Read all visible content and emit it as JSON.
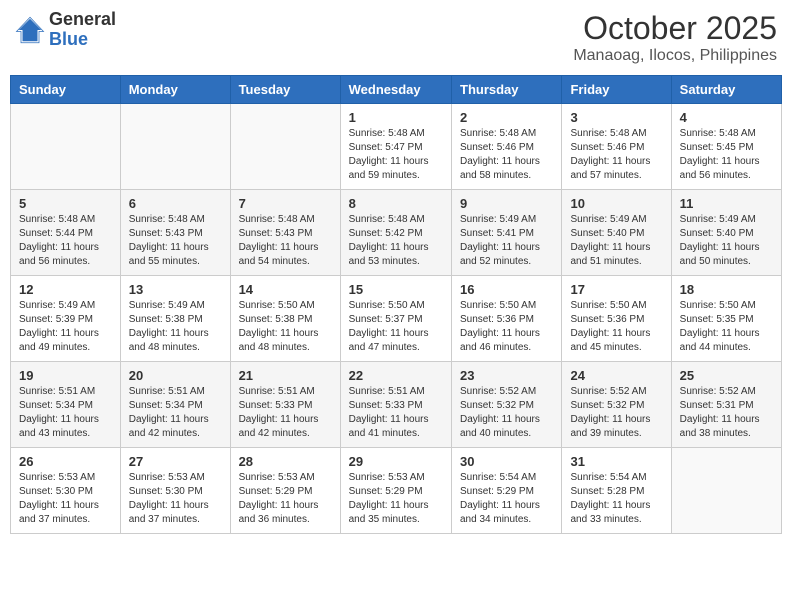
{
  "header": {
    "logo_general": "General",
    "logo_blue": "Blue",
    "month_title": "October 2025",
    "subtitle": "Manaoag, Ilocos, Philippines"
  },
  "days_of_week": [
    "Sunday",
    "Monday",
    "Tuesday",
    "Wednesday",
    "Thursday",
    "Friday",
    "Saturday"
  ],
  "weeks": [
    [
      {
        "day": "",
        "info": ""
      },
      {
        "day": "",
        "info": ""
      },
      {
        "day": "",
        "info": ""
      },
      {
        "day": "1",
        "info": "Sunrise: 5:48 AM\nSunset: 5:47 PM\nDaylight: 11 hours\nand 59 minutes."
      },
      {
        "day": "2",
        "info": "Sunrise: 5:48 AM\nSunset: 5:46 PM\nDaylight: 11 hours\nand 58 minutes."
      },
      {
        "day": "3",
        "info": "Sunrise: 5:48 AM\nSunset: 5:46 PM\nDaylight: 11 hours\nand 57 minutes."
      },
      {
        "day": "4",
        "info": "Sunrise: 5:48 AM\nSunset: 5:45 PM\nDaylight: 11 hours\nand 56 minutes."
      }
    ],
    [
      {
        "day": "5",
        "info": "Sunrise: 5:48 AM\nSunset: 5:44 PM\nDaylight: 11 hours\nand 56 minutes."
      },
      {
        "day": "6",
        "info": "Sunrise: 5:48 AM\nSunset: 5:43 PM\nDaylight: 11 hours\nand 55 minutes."
      },
      {
        "day": "7",
        "info": "Sunrise: 5:48 AM\nSunset: 5:43 PM\nDaylight: 11 hours\nand 54 minutes."
      },
      {
        "day": "8",
        "info": "Sunrise: 5:48 AM\nSunset: 5:42 PM\nDaylight: 11 hours\nand 53 minutes."
      },
      {
        "day": "9",
        "info": "Sunrise: 5:49 AM\nSunset: 5:41 PM\nDaylight: 11 hours\nand 52 minutes."
      },
      {
        "day": "10",
        "info": "Sunrise: 5:49 AM\nSunset: 5:40 PM\nDaylight: 11 hours\nand 51 minutes."
      },
      {
        "day": "11",
        "info": "Sunrise: 5:49 AM\nSunset: 5:40 PM\nDaylight: 11 hours\nand 50 minutes."
      }
    ],
    [
      {
        "day": "12",
        "info": "Sunrise: 5:49 AM\nSunset: 5:39 PM\nDaylight: 11 hours\nand 49 minutes."
      },
      {
        "day": "13",
        "info": "Sunrise: 5:49 AM\nSunset: 5:38 PM\nDaylight: 11 hours\nand 48 minutes."
      },
      {
        "day": "14",
        "info": "Sunrise: 5:50 AM\nSunset: 5:38 PM\nDaylight: 11 hours\nand 48 minutes."
      },
      {
        "day": "15",
        "info": "Sunrise: 5:50 AM\nSunset: 5:37 PM\nDaylight: 11 hours\nand 47 minutes."
      },
      {
        "day": "16",
        "info": "Sunrise: 5:50 AM\nSunset: 5:36 PM\nDaylight: 11 hours\nand 46 minutes."
      },
      {
        "day": "17",
        "info": "Sunrise: 5:50 AM\nSunset: 5:36 PM\nDaylight: 11 hours\nand 45 minutes."
      },
      {
        "day": "18",
        "info": "Sunrise: 5:50 AM\nSunset: 5:35 PM\nDaylight: 11 hours\nand 44 minutes."
      }
    ],
    [
      {
        "day": "19",
        "info": "Sunrise: 5:51 AM\nSunset: 5:34 PM\nDaylight: 11 hours\nand 43 minutes."
      },
      {
        "day": "20",
        "info": "Sunrise: 5:51 AM\nSunset: 5:34 PM\nDaylight: 11 hours\nand 42 minutes."
      },
      {
        "day": "21",
        "info": "Sunrise: 5:51 AM\nSunset: 5:33 PM\nDaylight: 11 hours\nand 42 minutes."
      },
      {
        "day": "22",
        "info": "Sunrise: 5:51 AM\nSunset: 5:33 PM\nDaylight: 11 hours\nand 41 minutes."
      },
      {
        "day": "23",
        "info": "Sunrise: 5:52 AM\nSunset: 5:32 PM\nDaylight: 11 hours\nand 40 minutes."
      },
      {
        "day": "24",
        "info": "Sunrise: 5:52 AM\nSunset: 5:32 PM\nDaylight: 11 hours\nand 39 minutes."
      },
      {
        "day": "25",
        "info": "Sunrise: 5:52 AM\nSunset: 5:31 PM\nDaylight: 11 hours\nand 38 minutes."
      }
    ],
    [
      {
        "day": "26",
        "info": "Sunrise: 5:53 AM\nSunset: 5:30 PM\nDaylight: 11 hours\nand 37 minutes."
      },
      {
        "day": "27",
        "info": "Sunrise: 5:53 AM\nSunset: 5:30 PM\nDaylight: 11 hours\nand 37 minutes."
      },
      {
        "day": "28",
        "info": "Sunrise: 5:53 AM\nSunset: 5:29 PM\nDaylight: 11 hours\nand 36 minutes."
      },
      {
        "day": "29",
        "info": "Sunrise: 5:53 AM\nSunset: 5:29 PM\nDaylight: 11 hours\nand 35 minutes."
      },
      {
        "day": "30",
        "info": "Sunrise: 5:54 AM\nSunset: 5:29 PM\nDaylight: 11 hours\nand 34 minutes."
      },
      {
        "day": "31",
        "info": "Sunrise: 5:54 AM\nSunset: 5:28 PM\nDaylight: 11 hours\nand 33 minutes."
      },
      {
        "day": "",
        "info": ""
      }
    ]
  ]
}
